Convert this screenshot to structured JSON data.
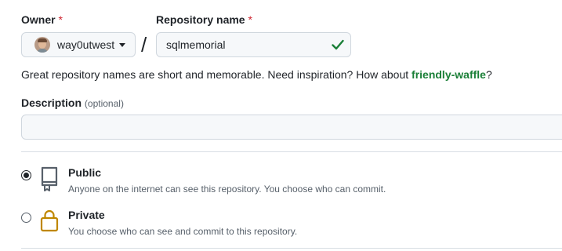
{
  "owner": {
    "label": "Owner",
    "required_mark": "*",
    "selected": "way0utwest"
  },
  "separator": "/",
  "repo_name": {
    "label": "Repository name",
    "required_mark": "*",
    "value": "sqlmemorial",
    "status": "valid"
  },
  "hint": {
    "text": "Great repository names are short and memorable. Need inspiration? How about ",
    "suggestion": "friendly-waffle",
    "suffix": "?"
  },
  "description": {
    "label": "Description",
    "optional": "(optional)",
    "value": ""
  },
  "visibility": {
    "options": [
      {
        "title": "Public",
        "desc": "Anyone on the internet can see this repository. You choose who can commit.",
        "selected": true,
        "icon": "repo-icon"
      },
      {
        "title": "Private",
        "desc": "You choose who can see and commit to this repository.",
        "selected": false,
        "icon": "lock-icon"
      }
    ]
  },
  "colors": {
    "required": "#cf222e",
    "success": "#1a7f37",
    "lock_icon": "#bf8700"
  }
}
